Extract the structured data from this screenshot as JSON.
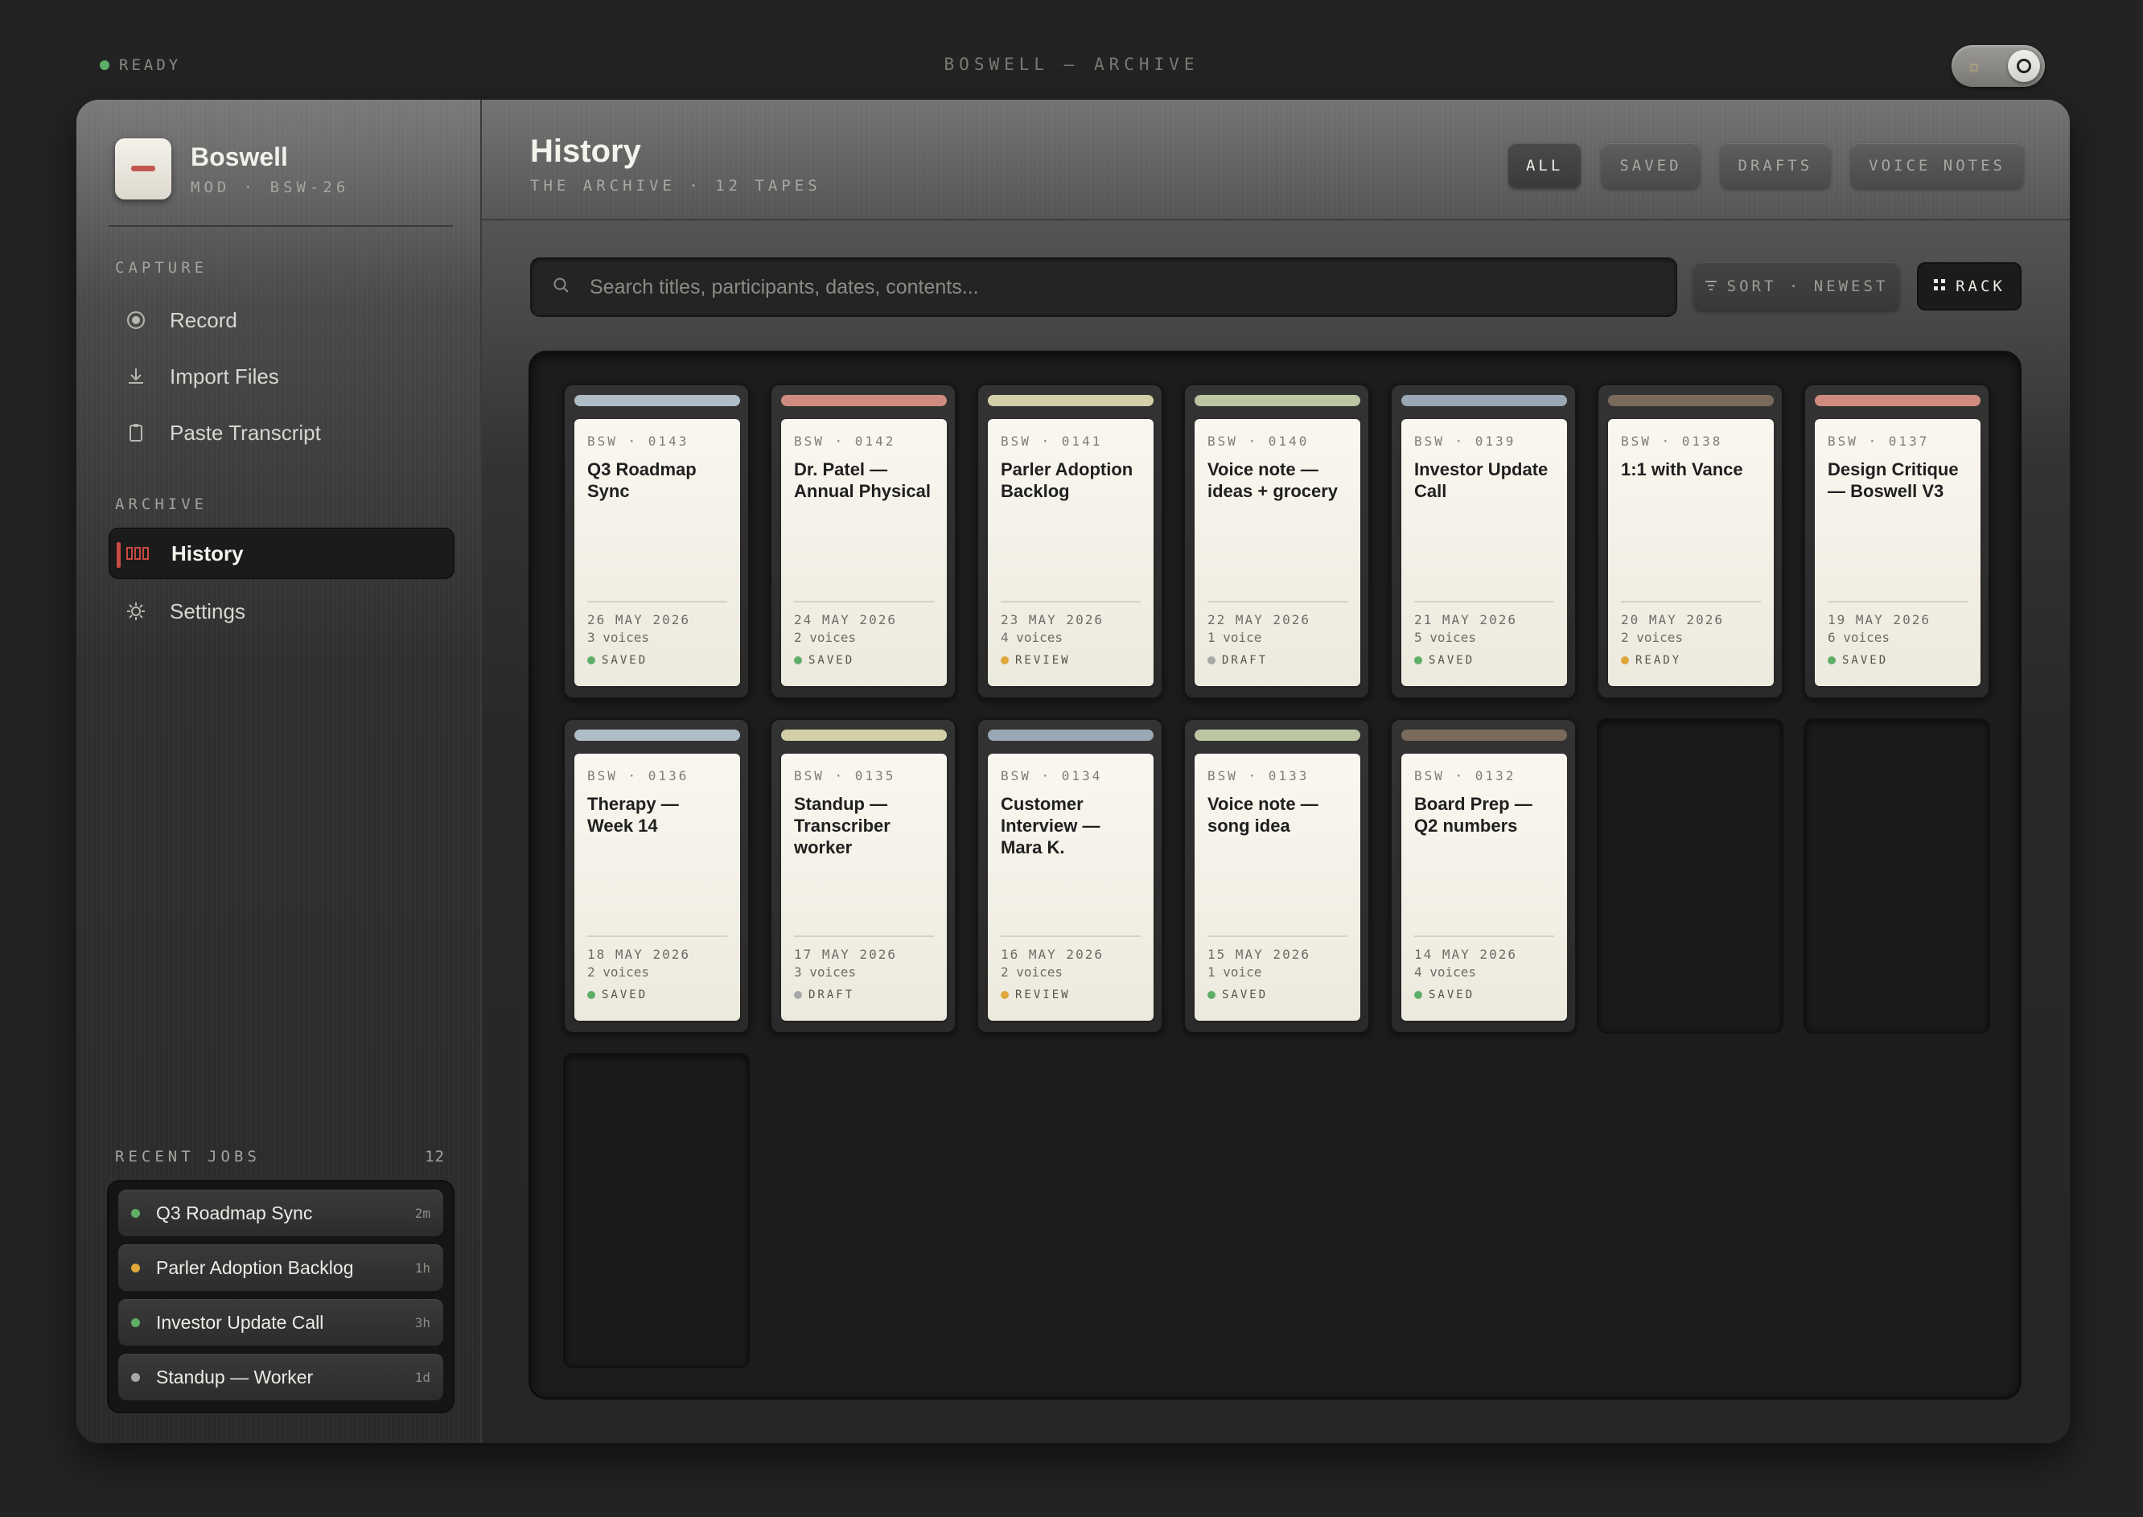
{
  "topbar": {
    "status": "READY",
    "title": "BOSWELL — ARCHIVE"
  },
  "brand": {
    "name": "Boswell",
    "model": "MOD · BSW-26"
  },
  "sidebar": {
    "capture_label": "CAPTURE",
    "capture_items": [
      {
        "label": "Record",
        "icon": "record-icon"
      },
      {
        "label": "Import Files",
        "icon": "import-icon"
      },
      {
        "label": "Paste Transcript",
        "icon": "clipboard-icon"
      }
    ],
    "archive_label": "ARCHIVE",
    "archive_items": [
      {
        "label": "History",
        "icon": "tape-icon",
        "active": true
      },
      {
        "label": "Settings",
        "icon": "gear-icon",
        "active": false
      }
    ],
    "recent_label": "RECENT JOBS",
    "recent_count": "12",
    "recent_jobs": [
      {
        "label": "Q3 Roadmap Sync",
        "time": "2m",
        "status_color": "#5fae68"
      },
      {
        "label": "Parler Adoption Backlog",
        "time": "1h",
        "status_color": "#e0a63a"
      },
      {
        "label": "Investor Update Call",
        "time": "3h",
        "status_color": "#5fae68"
      },
      {
        "label": "Standup — Worker",
        "time": "1d",
        "status_color": "#a8a8a8"
      }
    ]
  },
  "header": {
    "title": "History",
    "subtitle": "THE ARCHIVE · 12 TAPES",
    "filters": [
      "ALL",
      "SAVED",
      "DRAFTS",
      "VOICE NOTES"
    ],
    "active_filter": "ALL"
  },
  "search": {
    "placeholder": "Search titles, participants, dates, contents..."
  },
  "controls": {
    "sort_label": "SORT · NEWEST",
    "view_label": "RACK"
  },
  "tapes": [
    {
      "code": "BSW · 0143",
      "title": "Q3 Roadmap Sync",
      "date": "26 MAY 2026",
      "voices": "3 voices",
      "status": "SAVED",
      "status_color": "#5fae68",
      "spine_color": "#aebdc6"
    },
    {
      "code": "BSW · 0142",
      "title": "Dr. Patel — Annual Physical",
      "date": "24 MAY 2026",
      "voices": "2 voices",
      "status": "SAVED",
      "status_color": "#5fae68",
      "spine_color": "#cf8c7e"
    },
    {
      "code": "BSW · 0141",
      "title": "Parler Adoption Backlog",
      "date": "23 MAY 2026",
      "voices": "4 voices",
      "status": "REVIEW",
      "status_color": "#e0a63a",
      "spine_color": "#d3cfa8"
    },
    {
      "code": "BSW · 0140",
      "title": "Voice note — ideas + grocery",
      "date": "22 MAY 2026",
      "voices": "1 voice",
      "status": "DRAFT",
      "status_color": "#a8a8a8",
      "spine_color": "#bcc6a2"
    },
    {
      "code": "BSW · 0139",
      "title": "Investor Update Call",
      "date": "21 MAY 2026",
      "voices": "5 voices",
      "status": "SAVED",
      "status_color": "#5fae68",
      "spine_color": "#9aa7b4"
    },
    {
      "code": "BSW · 0138",
      "title": "1:1 with Vance",
      "date": "20 MAY 2026",
      "voices": "2 voices",
      "status": "READY",
      "status_color": "#e0a63a",
      "spine_color": "#7a6a5c"
    },
    {
      "code": "BSW · 0137",
      "title": "Design Critique — Boswell V3",
      "date": "19 MAY 2026",
      "voices": "6 voices",
      "status": "SAVED",
      "status_color": "#5fae68",
      "spine_color": "#cf8c7e"
    },
    {
      "code": "BSW · 0136",
      "title": "Therapy — Week 14",
      "date": "18 MAY 2026",
      "voices": "2 voices",
      "status": "SAVED",
      "status_color": "#5fae68",
      "spine_color": "#aebdc6"
    },
    {
      "code": "BSW · 0135",
      "title": "Standup — Transcriber worker",
      "date": "17 MAY 2026",
      "voices": "3 voices",
      "status": "DRAFT",
      "status_color": "#a8a8a8",
      "spine_color": "#d3cfa8"
    },
    {
      "code": "BSW · 0134",
      "title": "Customer Interview — Mara K.",
      "date": "16 MAY 2026",
      "voices": "2 voices",
      "status": "REVIEW",
      "status_color": "#e0a63a",
      "spine_color": "#9aa7b4"
    },
    {
      "code": "BSW · 0133",
      "title": "Voice note — song idea",
      "date": "15 MAY 2026",
      "voices": "1 voice",
      "status": "SAVED",
      "status_color": "#5fae68",
      "spine_color": "#bcc6a2"
    },
    {
      "code": "BSW · 0132",
      "title": "Board Prep — Q2 numbers",
      "date": "14 MAY 2026",
      "voices": "4 voices",
      "status": "SAVED",
      "status_color": "#5fae68",
      "spine_color": "#7a6a5c"
    }
  ]
}
